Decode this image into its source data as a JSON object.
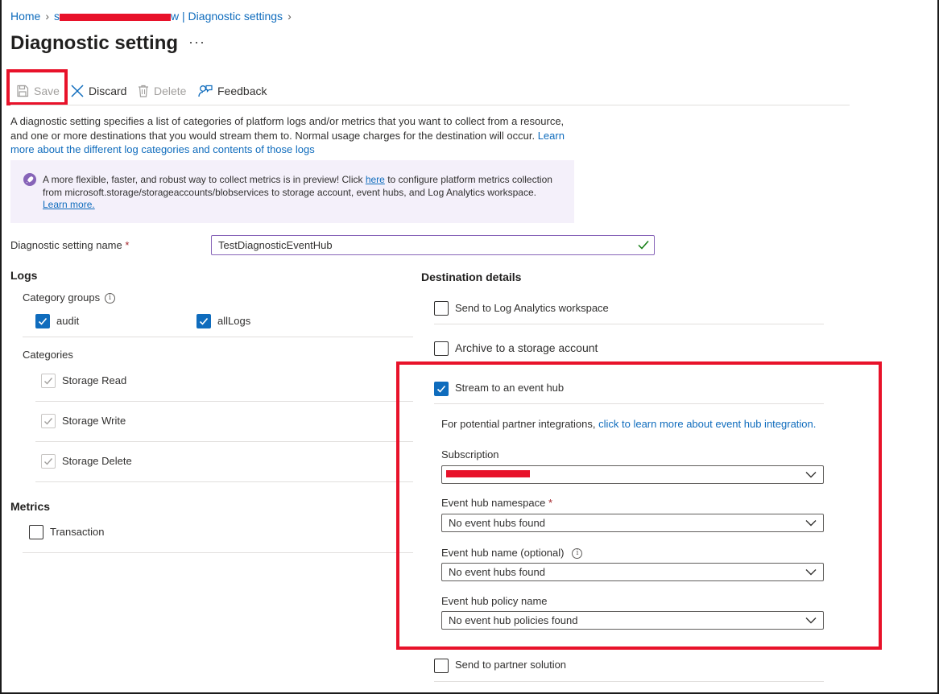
{
  "breadcrumb": {
    "home": "Home",
    "resource_prefix": "s",
    "resource_suffix": "w | Diagnostic settings"
  },
  "page": {
    "title": "Diagnostic setting",
    "more": "···"
  },
  "toolbar": {
    "save": "Save",
    "discard": "Discard",
    "delete": "Delete",
    "feedback": "Feedback"
  },
  "intro": {
    "text": "A diagnostic setting specifies a list of categories of platform logs and/or metrics that you want to collect from a resource, and one or more destinations that you would stream them to. Normal usage charges for the destination will occur. ",
    "link": "Learn more about the different log categories and contents of those logs"
  },
  "banner": {
    "text_before": "A more flexible, faster, and robust way to collect metrics is in preview! Click ",
    "here": "here",
    "text_after": " to configure platform metrics collection from microsoft.storage/storageaccounts/blobservices to storage account, event hubs, and Log Analytics workspace.",
    "learn_more": "Learn more."
  },
  "setting_name": {
    "label": "Diagnostic setting name",
    "required": "*",
    "value": "TestDiagnosticEventHub"
  },
  "logs": {
    "heading": "Logs",
    "category_groups_label": "Category groups",
    "groups": [
      {
        "label": "audit",
        "checked": true
      },
      {
        "label": "allLogs",
        "checked": true
      }
    ],
    "categories_label": "Categories",
    "categories": [
      {
        "label": "Storage Read",
        "checked": true,
        "disabled": true
      },
      {
        "label": "Storage Write",
        "checked": true,
        "disabled": true
      },
      {
        "label": "Storage Delete",
        "checked": true,
        "disabled": true
      }
    ]
  },
  "metrics": {
    "heading": "Metrics",
    "items": [
      {
        "label": "Transaction",
        "checked": false
      }
    ]
  },
  "destination": {
    "heading": "Destination details",
    "log_analytics": "Send to Log Analytics workspace",
    "storage": "Archive to a storage account",
    "event_hub": "Stream to an event hub",
    "partner_note": "For potential partner integrations, ",
    "partner_link": "click to learn more about event hub integration.",
    "subscription_label": "Subscription",
    "namespace_label": "Event hub namespace",
    "namespace_required": "*",
    "namespace_value": "No event hubs found",
    "hub_name_label": "Event hub name (optional)",
    "hub_name_value": "No event hubs found",
    "policy_label": "Event hub policy name",
    "policy_value": "No event hub policies found",
    "partner_solution": "Send to partner solution"
  },
  "colors": {
    "accent": "#0f6cbd",
    "highlight": "#e8122a",
    "banner_bg": "#f4f0fa"
  }
}
